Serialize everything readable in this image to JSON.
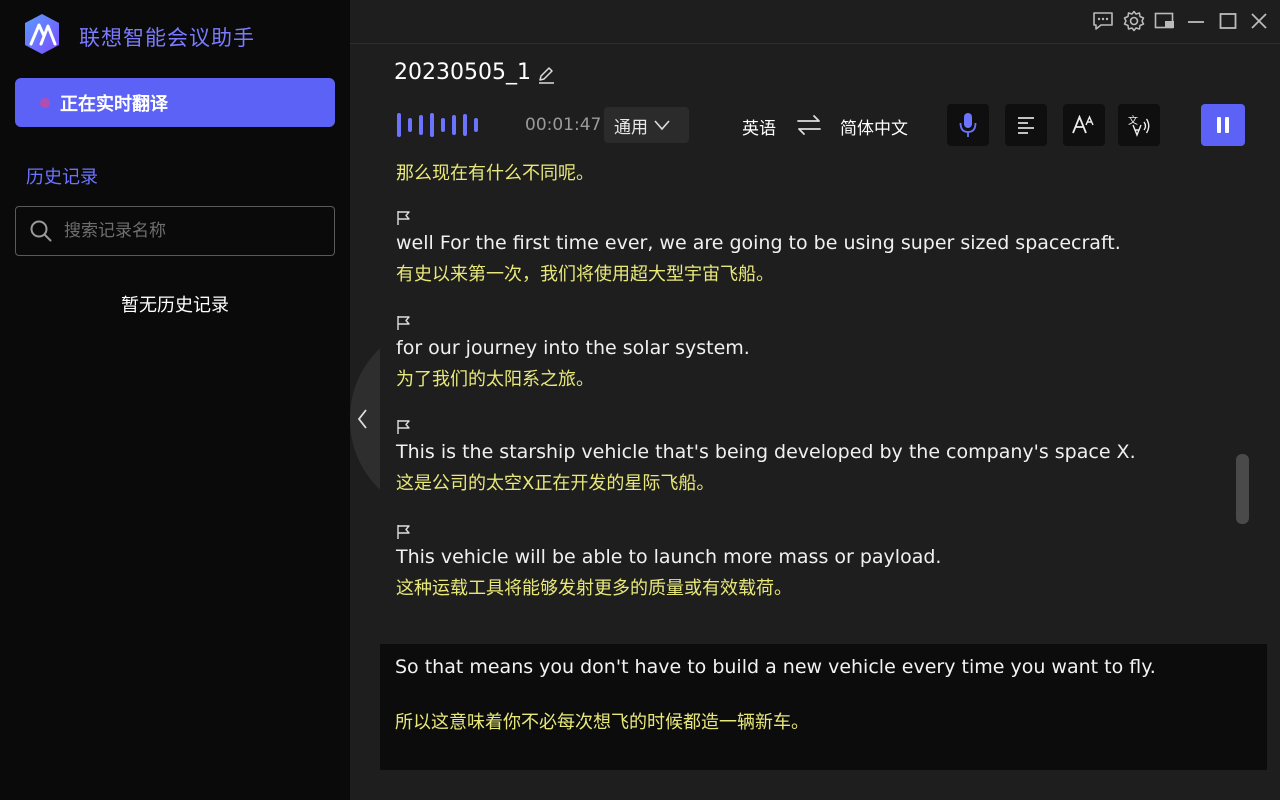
{
  "app": {
    "title": "联想智能会议助手"
  },
  "sidebar": {
    "live_button_label": "正在实时翻译",
    "history_label": "历史记录",
    "search_placeholder": "搜索记录名称",
    "empty_text": "暂无历史记录"
  },
  "session": {
    "title": "20230505_1"
  },
  "controls": {
    "timer": "00:01:47",
    "mode": "通用",
    "source_language": "英语",
    "target_language": "简体中文"
  },
  "transcript": {
    "first_partial_zh": "那么现在有什么不同呢。",
    "entries": [
      {
        "en": "well For the first time ever, we are going to be using super sized spacecraft.",
        "zh": "有史以来第一次，我们将使用超大型宇宙飞船。"
      },
      {
        "en": "for our journey into the solar system.",
        "zh": "为了我们的太阳系之旅。"
      },
      {
        "en": "This is the starship vehicle that's being developed by the company's space X.",
        "zh": "这是公司的太空X正在开发的星际飞船。"
      },
      {
        "en": "This vehicle will be able to launch more mass or payload.",
        "zh": "这种运载工具将能够发射更多的质量或有效载荷。"
      }
    ]
  },
  "live": {
    "en": "So that means you don't have to build a new vehicle every time you want to fly.",
    "zh": "所以这意味着你不必每次想飞的时候都造一辆新车。"
  },
  "colors": {
    "accent": "#5c62f5",
    "translation_text": "#e8e87a",
    "sidebar_bg": "#0a0a0a",
    "main_bg": "#1e1e1e"
  },
  "icons": {
    "window": [
      "feedback-icon",
      "settings-icon",
      "mini-window-icon",
      "minimize-icon",
      "maximize-icon",
      "close-icon"
    ],
    "tools": [
      "microphone-icon",
      "align-text-icon",
      "font-size-icon",
      "speech-translate-icon"
    ],
    "playback": "pause-icon"
  }
}
